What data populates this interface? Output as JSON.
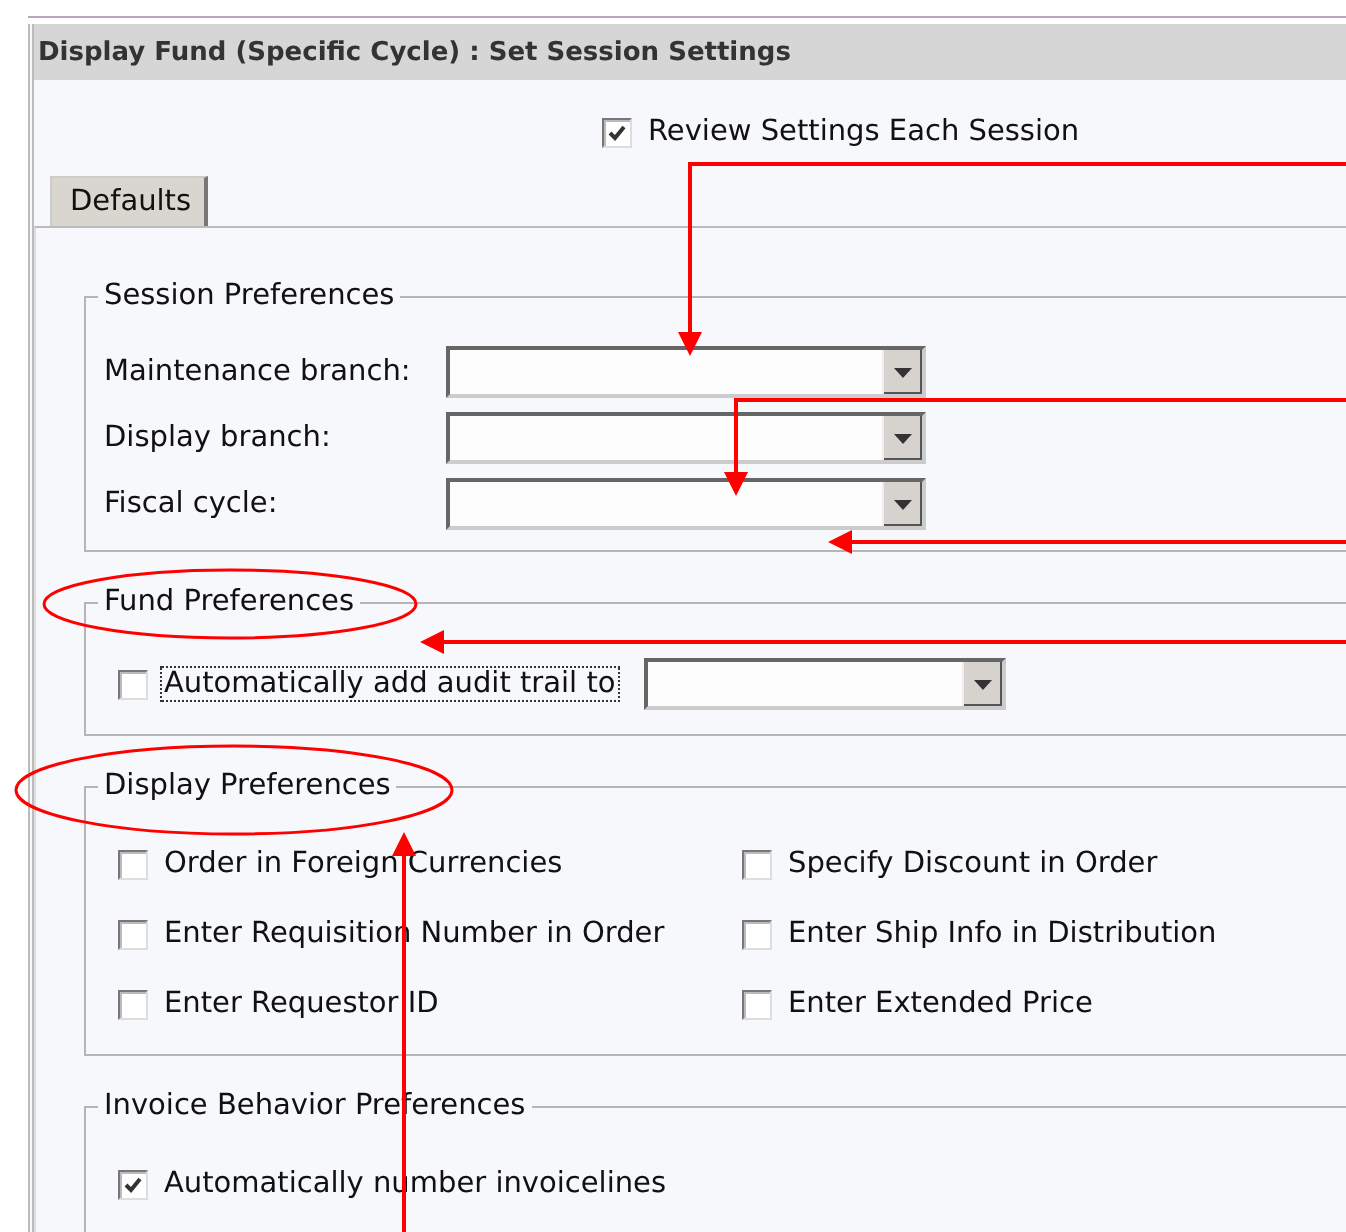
{
  "window": {
    "title": "Display Fund (Specific Cycle) : Set Session Settings"
  },
  "review_settings": {
    "label": "Review Settings Each Session",
    "checked": true
  },
  "tabs": [
    {
      "label": "Defaults",
      "selected": true
    }
  ],
  "session_preferences": {
    "title": "Session Preferences",
    "fields": [
      {
        "label": "Maintenance branch:"
      },
      {
        "label": "Display branch:"
      },
      {
        "label": "Fiscal cycle:"
      }
    ]
  },
  "fund_preferences": {
    "title": "Fund Preferences",
    "option": {
      "label": "Automatically add audit trail to",
      "checked": false,
      "focused": true
    }
  },
  "display_preferences": {
    "title": "Display Preferences",
    "options": [
      {
        "label": "Order in Foreign Currencies",
        "checked": false
      },
      {
        "label": "Specify Discount in Order",
        "checked": false
      },
      {
        "label": "Enter Requisition Number in Order",
        "checked": false
      },
      {
        "label": "Enter Ship Info in Distribution",
        "checked": false
      },
      {
        "label": "Enter Requestor ID",
        "checked": false
      },
      {
        "label": "Enter Extended Price",
        "checked": false
      }
    ]
  },
  "invoice_behavior_preferences": {
    "title": "Invoice Behavior Preferences",
    "options": [
      {
        "label": "Automatically number invoicelines",
        "checked": true
      }
    ]
  },
  "annotations": [
    {
      "kind": "arrow"
    },
    {
      "kind": "arrow"
    },
    {
      "kind": "arrow"
    },
    {
      "kind": "arrow"
    },
    {
      "kind": "arrow"
    },
    {
      "kind": "ellipse"
    },
    {
      "kind": "ellipse"
    }
  ]
}
